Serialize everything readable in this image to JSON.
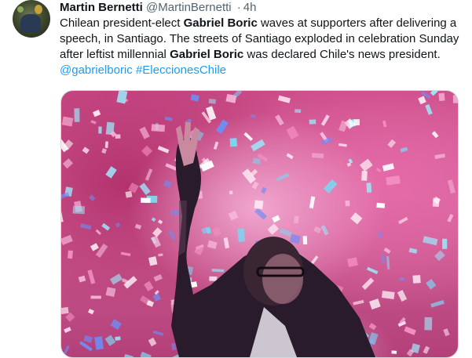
{
  "tweet": {
    "author_name": "Martin Bernetti",
    "handle": "@MartinBernetti",
    "separator": "·",
    "time": "4h",
    "text_parts": {
      "p1": "Chilean president-elect ",
      "b1": "Gabriel Boric",
      "p2": " waves at supporters after delivering a speech, in Santiago. The streets of Santiago exploded in celebration Sunday after leftist millennial ",
      "b2": "Gabriel Boric",
      "p3": " was declared Chile's news president. ",
      "mention": "@gabrielboric",
      "space": " ",
      "hashtag": "#EleccionesChile"
    },
    "colors": {
      "link": "#1d9bf0",
      "text": "#0f1419",
      "meta": "#536471"
    }
  }
}
